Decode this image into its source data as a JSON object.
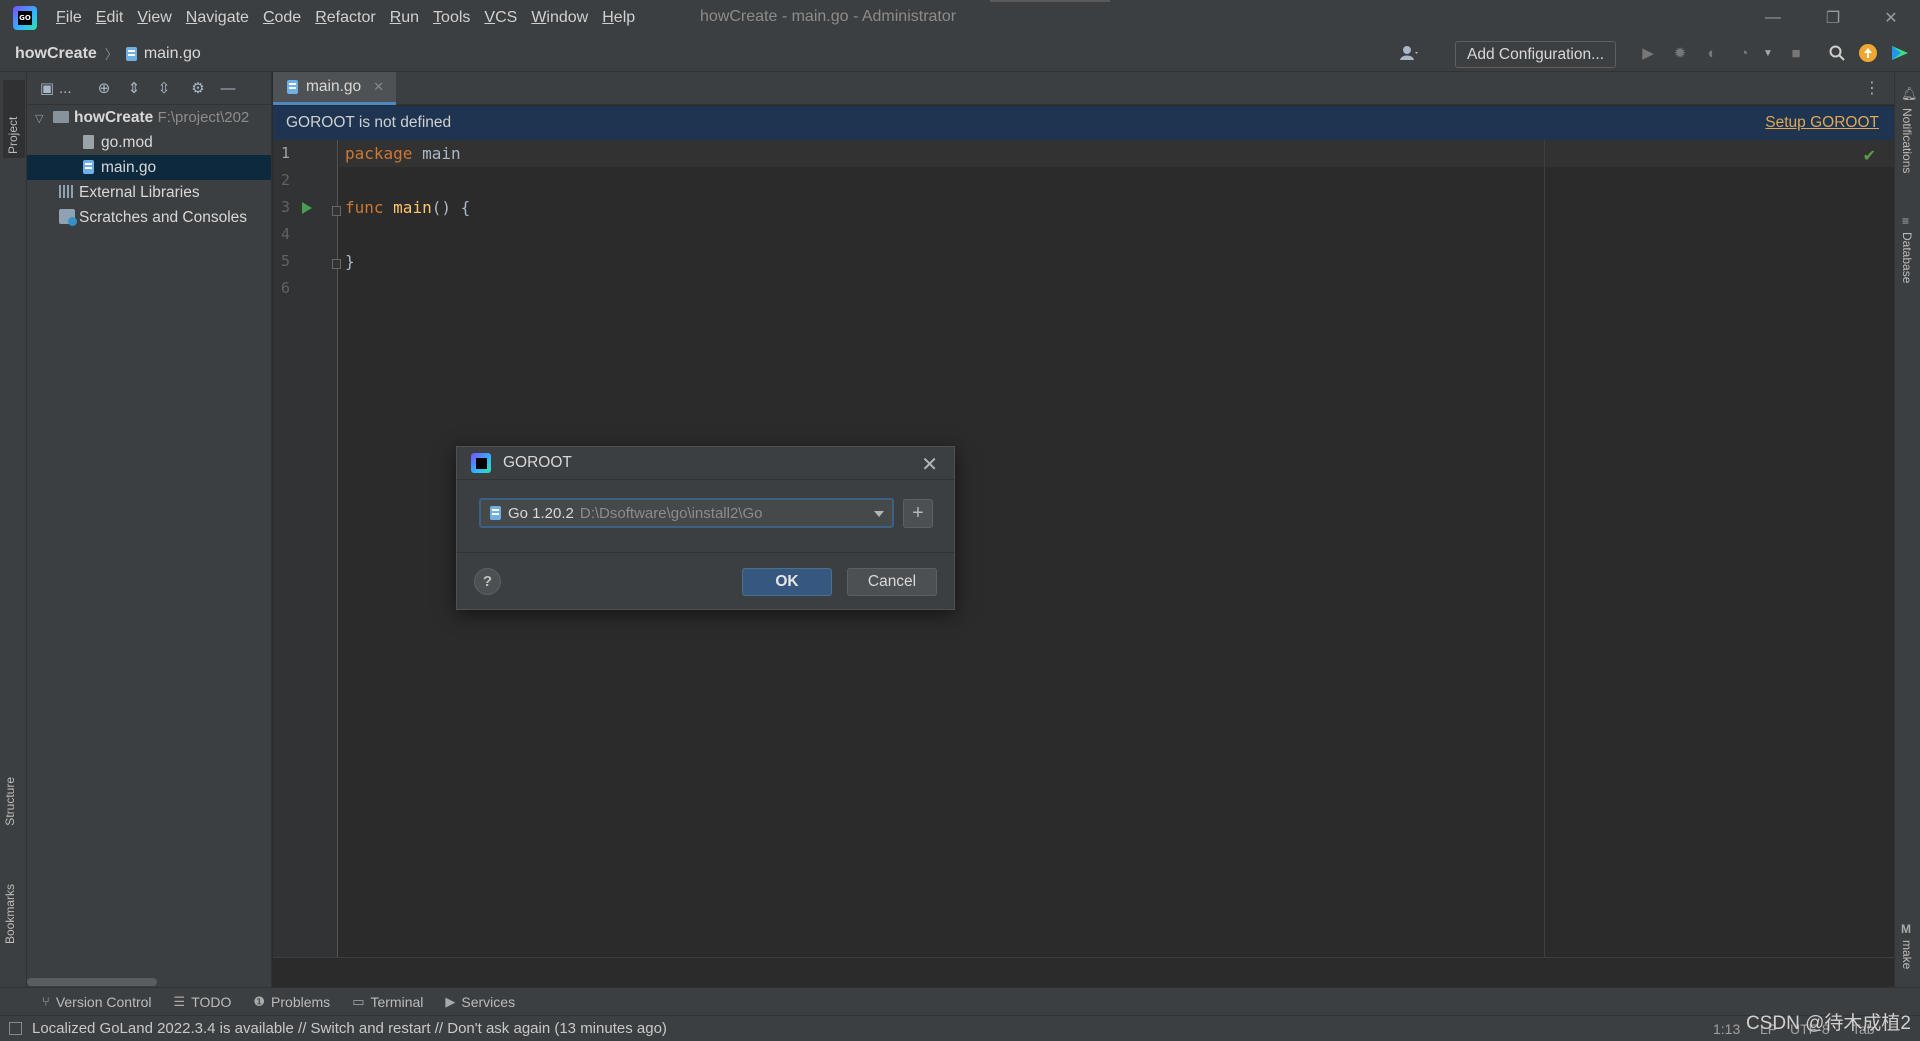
{
  "app": {
    "window_title": "howCreate - main.go - Administrator",
    "menu": [
      "File",
      "Edit",
      "View",
      "Navigate",
      "Code",
      "Refactor",
      "Run",
      "Tools",
      "VCS",
      "Window",
      "Help"
    ],
    "window_controls": {
      "minimize": "—",
      "restore": "❐",
      "close": "✕"
    }
  },
  "navbar": {
    "project": "howCreate",
    "file": "main.go",
    "add_configuration": "Add Configuration..."
  },
  "project_panel": {
    "tab_label": "Project",
    "toolbar_label": "...",
    "tree": [
      {
        "label": "howCreate",
        "path": "F:\\project\\202",
        "type": "folder",
        "expanded": true
      },
      {
        "label": "go.mod",
        "type": "file"
      },
      {
        "label": "main.go",
        "type": "go-file",
        "selected": true
      },
      {
        "label": "External Libraries",
        "type": "library"
      },
      {
        "label": "Scratches and Consoles",
        "type": "scratches"
      }
    ]
  },
  "left_strip": {
    "structure": "Structure",
    "bookmarks": "Bookmarks"
  },
  "right_strip": {
    "notifications": "Notifications",
    "database": "Database",
    "make": "make"
  },
  "editor": {
    "tab": "main.go",
    "banner": {
      "message": "GOROOT is not defined",
      "action": "Setup GOROOT"
    },
    "line_numbers": [
      "1",
      "2",
      "3",
      "4",
      "5",
      "6"
    ],
    "lines": {
      "l1_kw": "package",
      "l1_rest": " main",
      "l3_kw": "func",
      "l3_fn": "main",
      "l3_rest": "() {",
      "l5": "}"
    }
  },
  "dialog": {
    "title": "GOROOT",
    "sdk_name": "Go 1.20.2",
    "sdk_path": "D:\\Dsoftware\\go\\install2\\Go",
    "add_icon": "+",
    "help": "?",
    "ok": "OK",
    "cancel": "Cancel"
  },
  "toolwindows": [
    "Version Control",
    "TODO",
    "Problems",
    "Terminal",
    "Services"
  ],
  "statusbar": {
    "message": "Localized GoLand 2022.3.4 is available // Switch and restart // Don't ask again (13 minutes ago)",
    "position": "1:13",
    "line_sep": "LF",
    "encoding": "UTF-8",
    "indent": "Tab"
  },
  "watermark": "CSDN @待木成植2",
  "colors": {
    "banner_bg": "#1e3450",
    "link": "#e0a856",
    "selection": "#0d293e",
    "ok_button": "#365880"
  }
}
